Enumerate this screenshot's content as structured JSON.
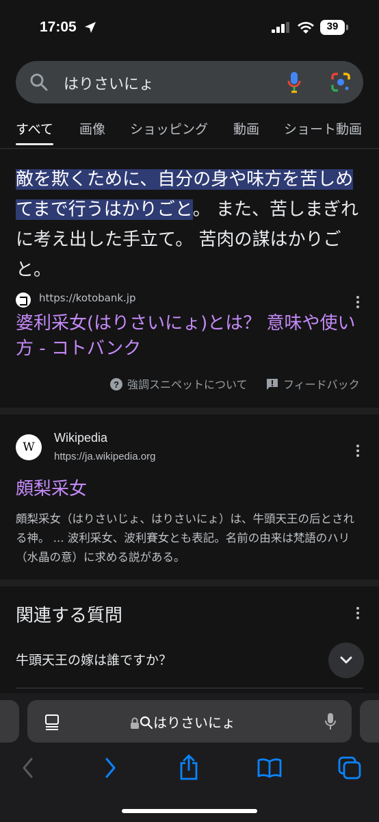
{
  "status_bar": {
    "time": "17:05",
    "battery": "39"
  },
  "search": {
    "query": "はりさいにょ"
  },
  "tabs": [
    "すべて",
    "画像",
    "ショッピング",
    "動画",
    "ショート動画"
  ],
  "featured_snippet": {
    "highlighted_text": "敵を欺くために、自分の身や味方を苦しめてまで行うはかりごと",
    "rest_text": "。 また、苦しまぎれに考え出した手立て。 苦肉の謀はかりごと。",
    "source_url": "https://kotobank.jp",
    "title": "婆利采女(はりさいにょ)とは？ 意味や使い方 - コトバンク",
    "about_label": "強調スニペットについて",
    "feedback_label": "フィードバック"
  },
  "wiki_result": {
    "logo": "W",
    "site_name": "Wikipedia",
    "url": "https://ja.wikipedia.org",
    "title": "頗梨采女",
    "description": "頗梨采女（はりさいじょ、はりさいにょ）は、牛頭天王の后とされる神。 ... 波利采女、波利賽女とも表記。名前の由来は梵語のハリ（水晶の意）に求める説がある。"
  },
  "related_questions": {
    "title": "関連する質問",
    "items": [
      "牛頭天王の嫁は誰ですか？"
    ]
  },
  "safari": {
    "address": "はりさいにょ"
  },
  "icons": {
    "search": "search-icon",
    "mic": "mic-icon",
    "lens": "google-lens-icon",
    "back": "back-arrow-icon",
    "forward": "forward-arrow-icon",
    "share": "share-icon",
    "bookmarks": "bookmarks-icon",
    "tabs": "tabs-icon"
  },
  "colors": {
    "link": "#c58af9",
    "highlight": "#2f3b73",
    "safari_blue": "#0a84ff"
  }
}
